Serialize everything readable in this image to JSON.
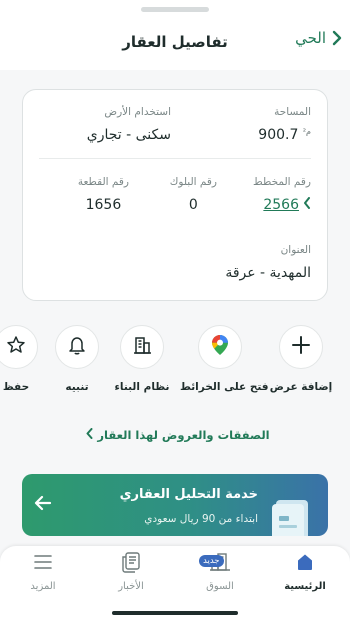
{
  "header": {
    "title": "تفاصيل العقار",
    "back_label": "الحي"
  },
  "details": {
    "area": {
      "label": "المساحة",
      "value": "900.7",
      "unit": "م²"
    },
    "land_use": {
      "label": "استخدام الأرض",
      "value": "سكنى - تجاري"
    },
    "plan_no": {
      "label": "رقم المخطط",
      "value": "2566"
    },
    "block_no": {
      "label": "رقم البلوك",
      "value": "0"
    },
    "parcel_no": {
      "label": "رقم القطعة",
      "value": "1656"
    },
    "address": {
      "label": "العنوان",
      "value": "المهدية - عرقة"
    }
  },
  "actions": [
    {
      "label": "إضافة عرض",
      "icon": "plus-icon"
    },
    {
      "label": "فتح على الخرائط",
      "icon": "map-pin-icon"
    },
    {
      "label": "نظام البناء",
      "icon": "building-icon"
    },
    {
      "label": "تنبيه",
      "icon": "bell-icon"
    },
    {
      "label": "حفظ",
      "icon": "star-icon"
    }
  ],
  "deals_link": "الصفقات والعروض لهذا العقار",
  "promo": {
    "title": "خدمة التحليل العقاري",
    "subtitle": "ابتداء من 90 ريال سعودي"
  },
  "bottom_nav": [
    {
      "label": "الرئيسية",
      "icon": "home-icon",
      "active": true
    },
    {
      "label": "السوق",
      "icon": "market-icon",
      "badge": "جديد"
    },
    {
      "label": "الأخبار",
      "icon": "news-icon"
    },
    {
      "label": "المزيد",
      "icon": "menu-icon"
    }
  ],
  "colors": {
    "accent": "#217a58",
    "text": "#1f2d2c",
    "badge": "#3b6bbd"
  }
}
